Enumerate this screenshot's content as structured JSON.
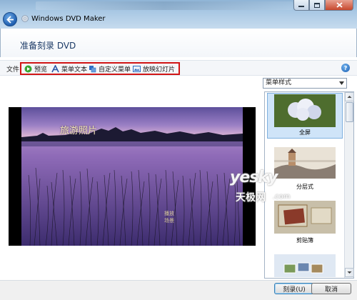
{
  "window": {
    "title": "Windows DVD Maker",
    "min_label": "—",
    "max_label": "□",
    "close_label": "✕"
  },
  "page": {
    "title": "准备刻录 DVD"
  },
  "toolbar": {
    "file": "文件",
    "preview": "预览",
    "menu_text": "菜单文本",
    "customize_menu": "自定义菜单",
    "slideshow": "放映幻灯片",
    "help": "?"
  },
  "menu_styles": {
    "selected": "菜单样式",
    "items": [
      {
        "label": "全屏"
      },
      {
        "label": "分层式"
      },
      {
        "label": "剪贴簿"
      }
    ]
  },
  "preview": {
    "title": "旅游照片",
    "play_button": "播放",
    "scenes_button": "场景"
  },
  "buttons": {
    "burn": "刻录(U)",
    "cancel": "取消"
  },
  "watermark": {
    "brand": "yesky",
    "chinese": "天极网",
    "domain": ".com"
  },
  "colors": {
    "accent_blue": "#1c3a66",
    "highlight_red": "#d11515",
    "selection": "#cfe4f8"
  }
}
